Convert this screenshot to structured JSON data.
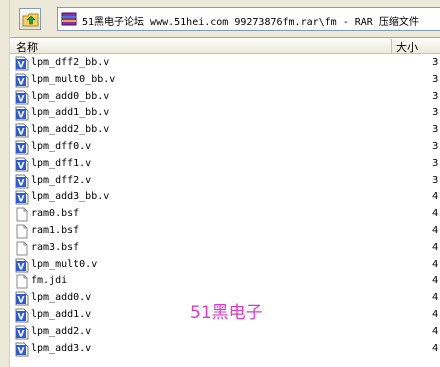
{
  "address_bar": {
    "path_text": "51黑电子论坛 www.51hei.com 99273876fm.rar\\fm - RAR 压缩文件"
  },
  "columns": {
    "name": "名称",
    "size": "大小"
  },
  "files": [
    {
      "name": "lpm_dff2_bb.v",
      "size": "3",
      "type": "verilog"
    },
    {
      "name": "lpm_mult0_bb.v",
      "size": "3",
      "type": "verilog"
    },
    {
      "name": "lpm_add0_bb.v",
      "size": "3",
      "type": "verilog"
    },
    {
      "name": "lpm_add1_bb.v",
      "size": "3",
      "type": "verilog"
    },
    {
      "name": "lpm_add2_bb.v",
      "size": "3",
      "type": "verilog"
    },
    {
      "name": "lpm_dff0.v",
      "size": "3",
      "type": "verilog"
    },
    {
      "name": "lpm_dff1.v",
      "size": "3",
      "type": "verilog"
    },
    {
      "name": "lpm_dff2.v",
      "size": "3",
      "type": "verilog"
    },
    {
      "name": "lpm_add3_bb.v",
      "size": "4",
      "type": "verilog"
    },
    {
      "name": "ram0.bsf",
      "size": "4",
      "type": "blank"
    },
    {
      "name": "ram1.bsf",
      "size": "4",
      "type": "blank"
    },
    {
      "name": "ram3.bsf",
      "size": "4",
      "type": "blank"
    },
    {
      "name": "lpm_mult0.v",
      "size": "4",
      "type": "verilog"
    },
    {
      "name": "fm.jdi",
      "size": "4",
      "type": "blank"
    },
    {
      "name": "lpm_add0.v",
      "size": "4",
      "type": "verilog"
    },
    {
      "name": "lpm_add1.v",
      "size": "4",
      "type": "verilog"
    },
    {
      "name": "lpm_add2.v",
      "size": "4",
      "type": "verilog"
    },
    {
      "name": "lpm_add3.v",
      "size": "4",
      "type": "verilog"
    }
  ],
  "watermark": "51黑电子",
  "colors": {
    "verilog_icon": "#2f5bd3",
    "watermark": "#d63cc7"
  }
}
